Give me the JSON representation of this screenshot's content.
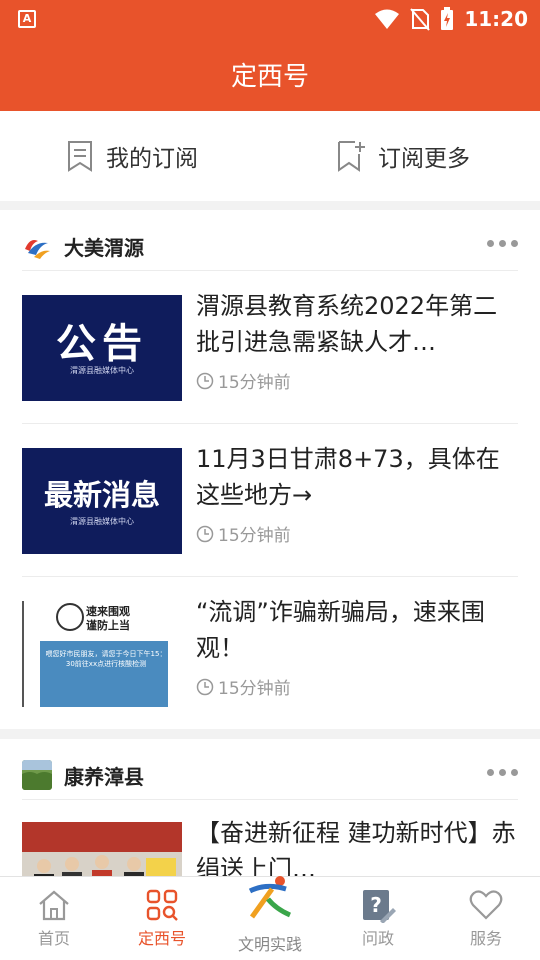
{
  "status_bar": {
    "app_badge": "A",
    "time": "11:20",
    "icons": [
      "wifi-icon",
      "no-sim-icon",
      "battery-charging-icon"
    ]
  },
  "header": {
    "title": "定西号"
  },
  "subscription": {
    "my_subscriptions": "我的订阅",
    "subscribe_more": "订阅更多",
    "icons": [
      "bookmark-list-icon",
      "bookmark-add-icon"
    ]
  },
  "colors": {
    "brand": "#e8532b",
    "text": "#222222",
    "meta": "#999999",
    "thumb_navy": "#0f1c5c"
  },
  "channels": [
    {
      "name": "大美渭源",
      "articles": [
        {
          "title": "渭源县教育系统2022年第二批引进急需紧缺人才…",
          "time": "15分钟前",
          "thumb_text": "公告",
          "thumb_sub": "渭源县融媒体中心"
        },
        {
          "title": "11月3日甘肃8+73，具体在这些地方→",
          "time": "15分钟前",
          "thumb_text": "最新消息",
          "thumb_sub": "渭源县融媒体中心"
        },
        {
          "title": "“流调”诈骗新骗局，速来围观！",
          "time": "15分钟前",
          "thumb_caption_1": "速来围观",
          "thumb_caption_2": "谨防上当",
          "thumb_board": "喂您好市民朋友，请您于今日下午15：30前往xx点进行核酸检测"
        }
      ]
    },
    {
      "name": "康养漳县",
      "articles": [
        {
          "title": "【奋进新征程 建功新时代】赤绢送上门…",
          "time": ""
        }
      ]
    }
  ],
  "tabbar": {
    "items": [
      {
        "label": "首页",
        "icon": "home-icon"
      },
      {
        "label": "定西号",
        "icon": "grid-search-icon"
      },
      {
        "label": "文明实践",
        "icon": "civilization-logo-icon"
      },
      {
        "label": "问政",
        "icon": "question-edit-icon"
      },
      {
        "label": "服务",
        "icon": "heart-icon"
      }
    ],
    "active": "定西号"
  }
}
